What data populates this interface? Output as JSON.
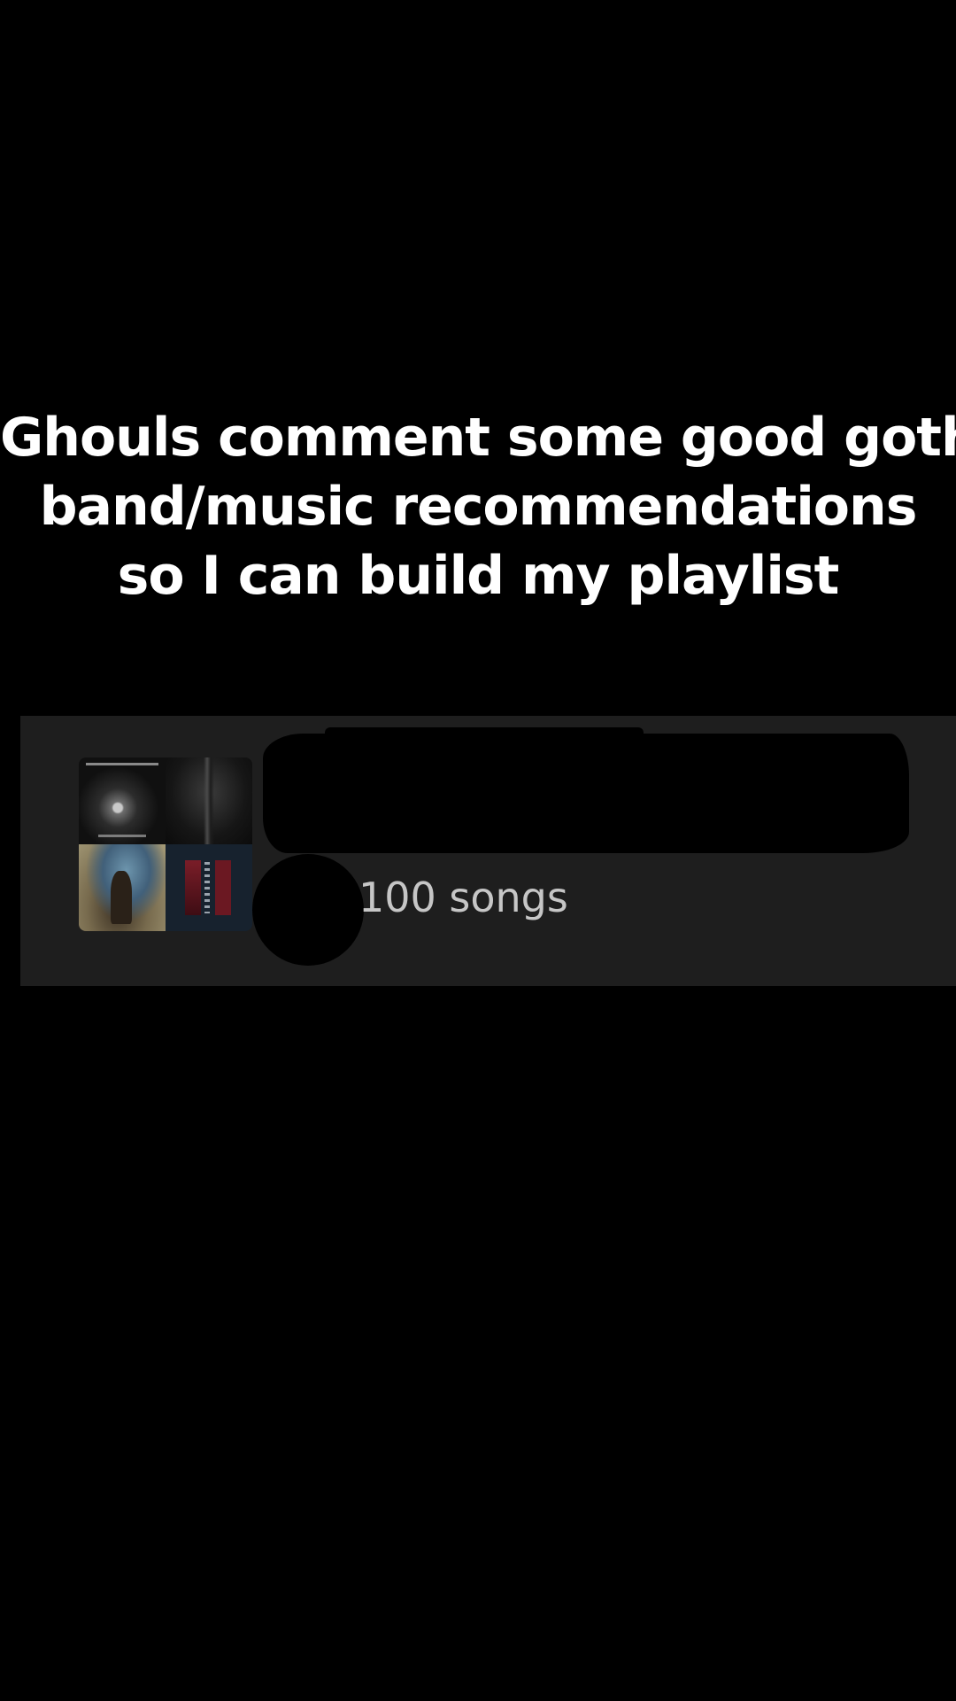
{
  "caption": {
    "lines": [
      "Ghouls comment some good goth",
      "band/music recommendations",
      "so I can build my playlist"
    ]
  },
  "playlist": {
    "song_count_label": "100 songs",
    "cover_tiles": [
      "album-cover",
      "album-cover",
      "album-cover",
      "album-cover"
    ],
    "name_redacted": true,
    "owner_avatar_redacted": true
  },
  "colors": {
    "background": "#000000",
    "caption_text": "#ffffff",
    "card_background": "#1e1e1e",
    "secondary_text": "#c6c6c6"
  }
}
